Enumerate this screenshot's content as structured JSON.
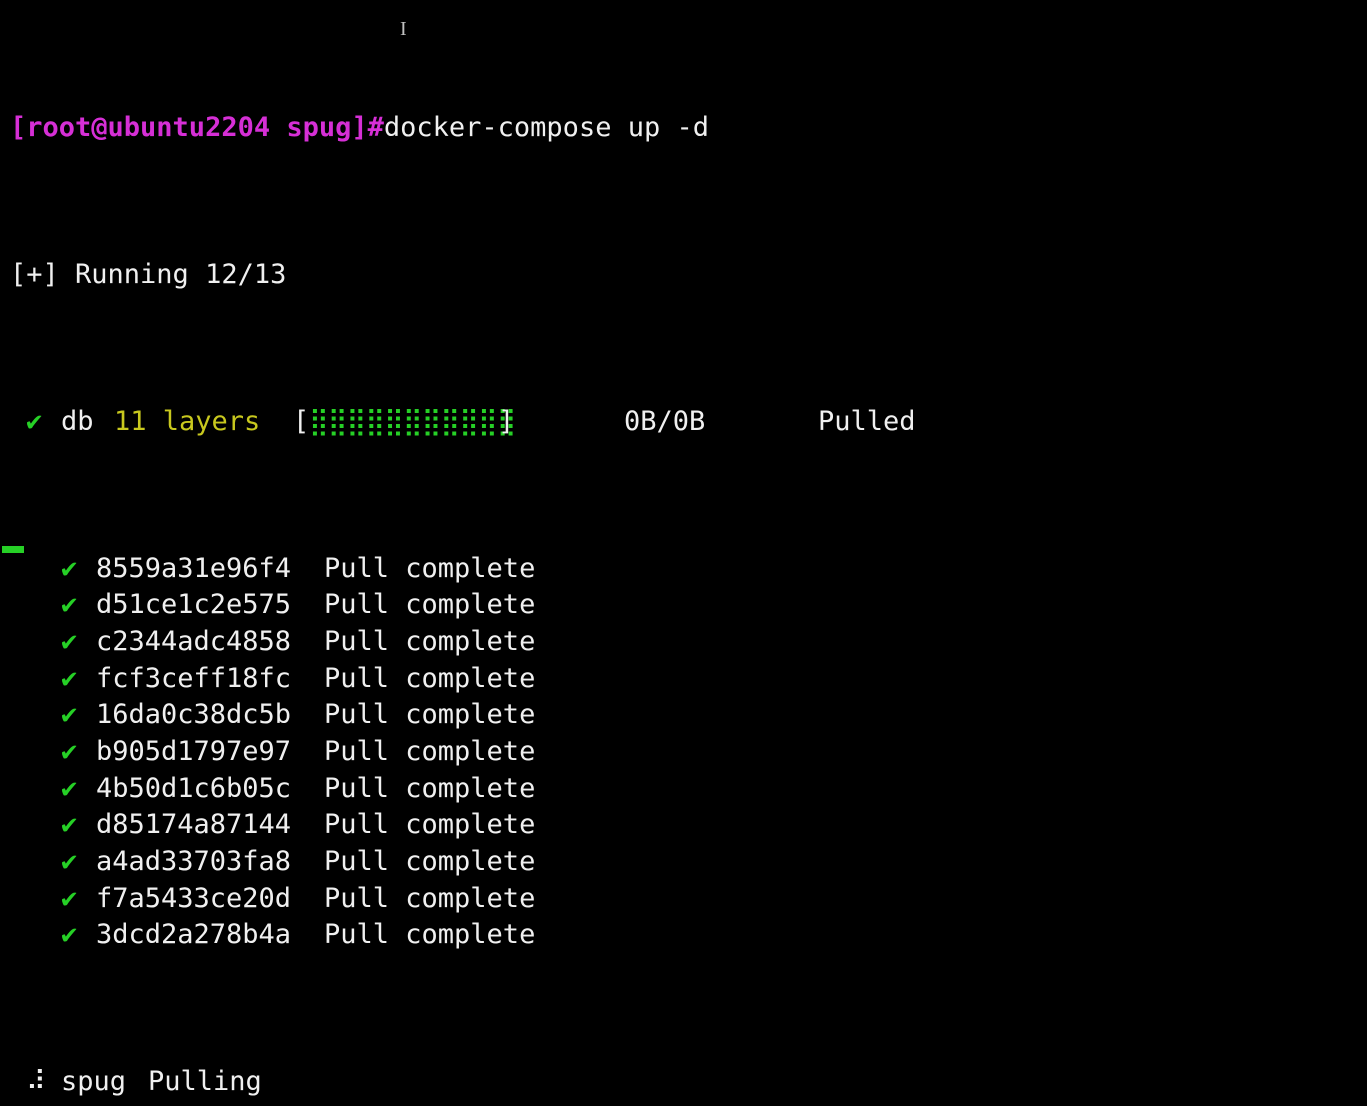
{
  "terminal": {
    "prompt": "[root@ubuntu2204 spug]#",
    "command": "docker-compose up -d",
    "running": "[+] Running 12/13",
    "db": {
      "check": "✔",
      "name": "db",
      "layers_label": "11 layers",
      "bar_open": "[",
      "bar_fill": "⣿⣿⣿⣿⣿⣿⣿⣿⣿⣿⣿",
      "bar_close": "]",
      "size": "0B/0B",
      "status": "Pulled"
    },
    "layers": [
      {
        "check": "✔",
        "id": "8559a31e96f4",
        "status": "Pull complete"
      },
      {
        "check": "✔",
        "id": "d51ce1c2e575",
        "status": "Pull complete"
      },
      {
        "check": "✔",
        "id": "c2344adc4858",
        "status": "Pull complete"
      },
      {
        "check": "✔",
        "id": "fcf3ceff18fc",
        "status": "Pull complete"
      },
      {
        "check": "✔",
        "id": "16da0c38dc5b",
        "status": "Pull complete"
      },
      {
        "check": "✔",
        "id": "b905d1797e97",
        "status": "Pull complete"
      },
      {
        "check": "✔",
        "id": "4b50d1c6b05c",
        "status": "Pull complete"
      },
      {
        "check": "✔",
        "id": "d85174a87144",
        "status": "Pull complete"
      },
      {
        "check": "✔",
        "id": "a4ad33703fa8",
        "status": "Pull complete"
      },
      {
        "check": "✔",
        "id": "f7a5433ce20d",
        "status": "Pull complete"
      },
      {
        "check": "✔",
        "id": "3dcd2a278b4a",
        "status": "Pull complete"
      }
    ],
    "spug": {
      "spinner": "⠼",
      "name": "spug",
      "status": "Pulling"
    },
    "colors": {
      "background": "#000000",
      "prompt": "#d62fd6",
      "check": "#26d026",
      "layers": "#c8c81e",
      "text": "#f0f0f0"
    }
  }
}
